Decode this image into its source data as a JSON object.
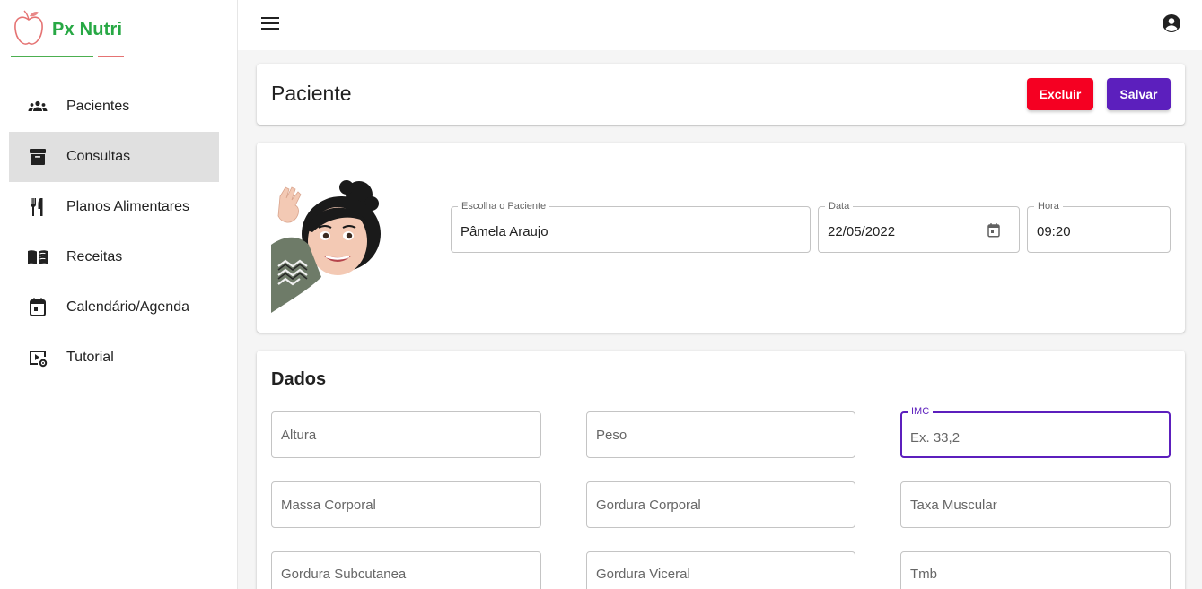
{
  "app": {
    "brand": "Px Nutri"
  },
  "sidebar": {
    "items": [
      {
        "label": "Pacientes",
        "icon": "groups-icon"
      },
      {
        "label": "Consultas",
        "icon": "archive-box-icon",
        "active": true
      },
      {
        "label": "Planos Alimentares",
        "icon": "restaurant-icon"
      },
      {
        "label": "Receitas",
        "icon": "menu-book-icon"
      },
      {
        "label": "Calendário/Agenda",
        "icon": "calendar-icon"
      },
      {
        "label": "Tutorial",
        "icon": "video-settings-icon"
      }
    ]
  },
  "topbar": {
    "menu_icon": "hamburger-menu-icon",
    "account_icon": "account-circle-icon"
  },
  "header": {
    "title": "Paciente",
    "delete_label": "Excluir",
    "save_label": "Salvar",
    "delete_color": "#f50022",
    "save_color": "#5c1fbd"
  },
  "patient": {
    "patient_label": "Escolha o Paciente",
    "patient_value": "Pâmela Araujo",
    "date_label": "Data",
    "date_value": "22/05/2022",
    "date_icon": "calendar-today-icon",
    "time_label": "Hora",
    "time_value": "09:20"
  },
  "dados": {
    "title": "Dados",
    "fields": [
      {
        "placeholder": "Altura"
      },
      {
        "placeholder": "Peso"
      },
      {
        "label": "IMC",
        "placeholder": "Ex. 33,2",
        "focused": true
      },
      {
        "placeholder": "Massa Corporal"
      },
      {
        "placeholder": "Gordura Corporal"
      },
      {
        "placeholder": "Taxa Muscular"
      },
      {
        "placeholder": "Gordura Subcutanea"
      },
      {
        "placeholder": "Gordura Viceral"
      },
      {
        "placeholder": "Tmb"
      }
    ]
  },
  "colors": {
    "brand_green": "#27a844",
    "accent_purple": "#5c1fbd",
    "danger_red": "#f50022"
  }
}
